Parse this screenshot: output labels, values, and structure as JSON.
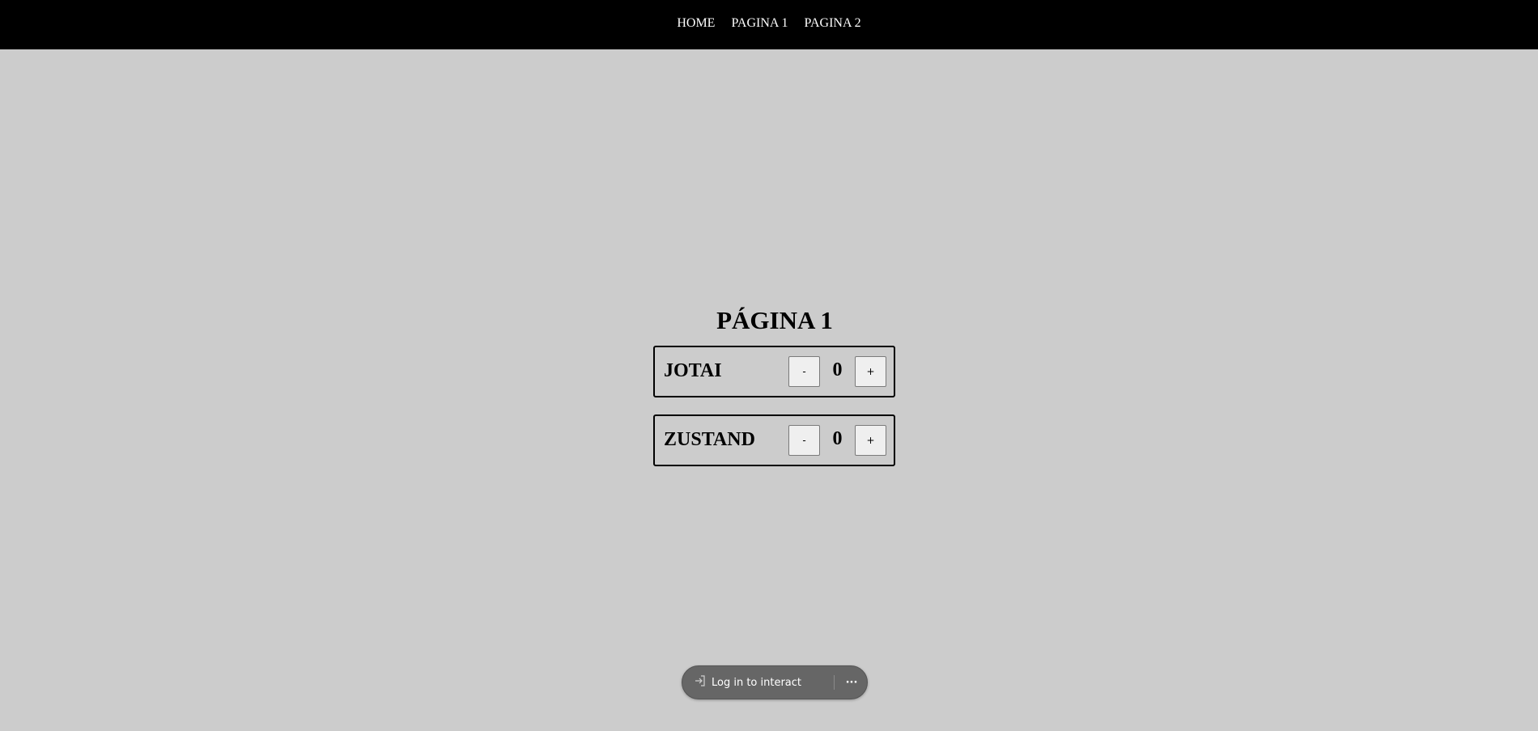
{
  "nav": {
    "links": [
      {
        "label": "HOME"
      },
      {
        "label": "PAGINA 1"
      },
      {
        "label": "PAGINA 2"
      }
    ]
  },
  "page": {
    "title": "PÁGINA 1"
  },
  "counters": [
    {
      "name": "JOTAI",
      "decrement_label": "-",
      "value": "0",
      "increment_label": "+"
    },
    {
      "name": "ZUSTAND",
      "decrement_label": "-",
      "value": "0",
      "increment_label": "+"
    }
  ],
  "login_bar": {
    "label": "Log in to interact",
    "login_icon": "login-arrow-icon",
    "more_icon": "more-dots-icon",
    "more_label": "···"
  },
  "colors": {
    "page_background": "#cccccc",
    "nav_background": "#000000",
    "nav_text": "#ffffff",
    "pill_background": "#666666"
  }
}
